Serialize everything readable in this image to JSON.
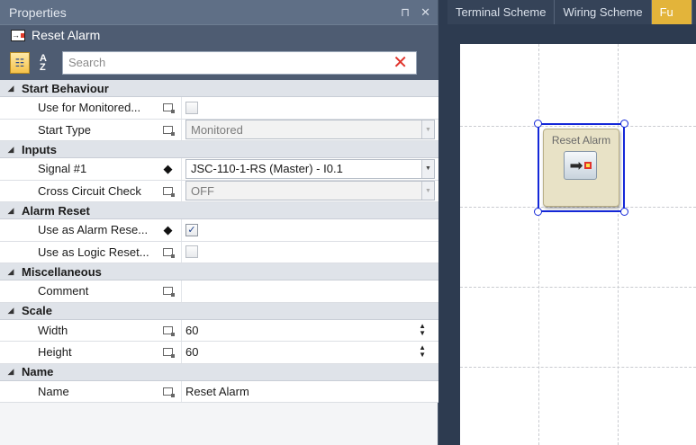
{
  "properties_panel": {
    "title": "Properties",
    "pin_icon": "pin-icon",
    "close_label": "✕",
    "object_name": "Reset Alarm",
    "search_placeholder": "Search",
    "categories": [
      {
        "name": "Start Behaviour",
        "rows": [
          {
            "label": "Use for Monitored...",
            "kind": "checkbox",
            "checked": false,
            "disabled": true
          },
          {
            "label": "Start Type",
            "kind": "combo",
            "value": "Monitored",
            "disabled": true
          }
        ]
      },
      {
        "name": "Inputs",
        "rows": [
          {
            "label": "Signal #1",
            "kind": "combo",
            "value": "JSC-110-1-RS (Master) - I0.1",
            "disabled": false
          },
          {
            "label": "Cross Circuit Check",
            "kind": "combo",
            "value": "OFF",
            "disabled": true
          }
        ]
      },
      {
        "name": "Alarm Reset",
        "rows": [
          {
            "label": "Use as Alarm Rese...",
            "kind": "checkbox",
            "checked": true,
            "disabled": false
          },
          {
            "label": "Use as Logic Reset...",
            "kind": "checkbox",
            "checked": false,
            "disabled": true
          }
        ]
      },
      {
        "name": "Miscellaneous",
        "rows": [
          {
            "label": "Comment",
            "kind": "text",
            "value": ""
          }
        ]
      },
      {
        "name": "Scale",
        "rows": [
          {
            "label": "Width",
            "kind": "spin",
            "value": "60"
          },
          {
            "label": "Height",
            "kind": "spin",
            "value": "60"
          }
        ]
      },
      {
        "name": "Name",
        "rows": [
          {
            "label": "Name",
            "kind": "text",
            "value": "Reset Alarm"
          }
        ]
      }
    ]
  },
  "tabs": [
    {
      "label": "Terminal Scheme",
      "active": false
    },
    {
      "label": "Wiring Scheme",
      "active": false
    },
    {
      "label": "Fu",
      "active": true
    }
  ],
  "canvas": {
    "block_label": "Reset Alarm"
  },
  "colors": {
    "accent_tab": "#e3b43a",
    "selection": "#1428d8",
    "panel_header": "#5f6f86"
  }
}
